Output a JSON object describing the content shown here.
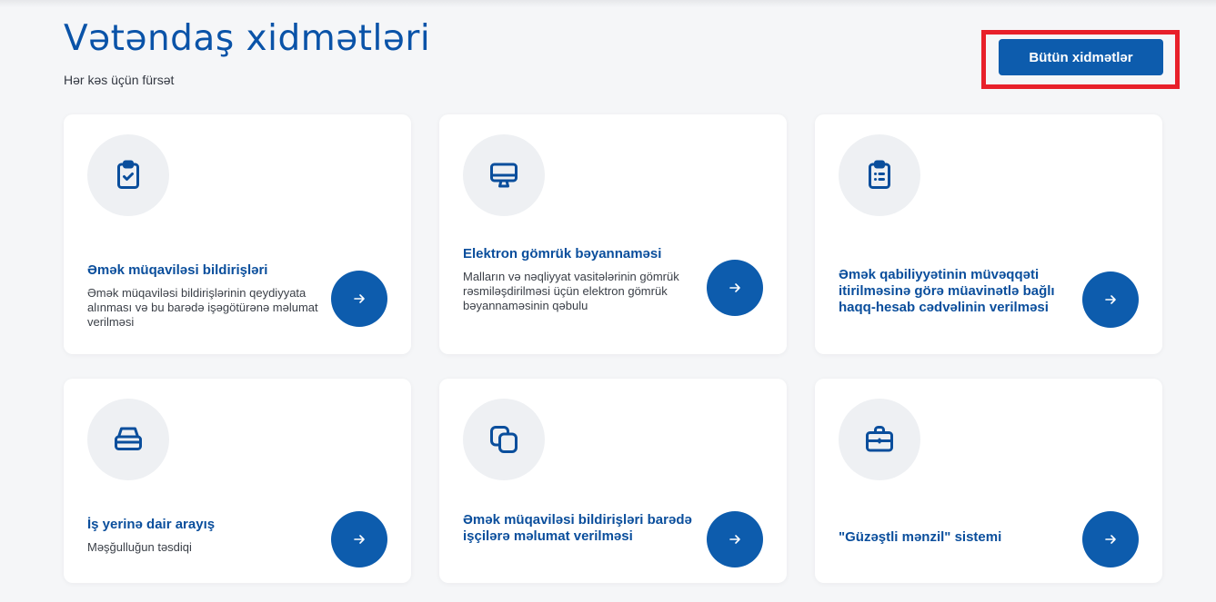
{
  "header": {
    "title": "Vətəndaş xidmətləri",
    "subtitle": "Hər kəs üçün fürsət",
    "all_services_label": "Bütün xidmətlər"
  },
  "colors": {
    "accent": "#0d5cad",
    "title": "#0a53a8",
    "highlight_frame": "#e8202a",
    "card_bg": "#ffffff",
    "page_bg": "#f5f6f8"
  },
  "cards": [
    {
      "icon": "clipboard-check-icon",
      "title": "Əmək müqaviləsi bildirişləri",
      "description": "Əmək müqaviləsi bildirişlərinin qeydiyyata alınması və bu barədə işəgötürənə məlumat verilməsi"
    },
    {
      "icon": "monitor-icon",
      "title": "Elektron gömrük bəyannaməsi",
      "description": "Malların və nəqliyyat vasitələrinin gömrük rəsmiləşdirilməsi üçün elektron gömrük bəyannaməsinin qəbulu"
    },
    {
      "icon": "clipboard-list-icon",
      "title": "Əmək qabiliyyətinin müvəqqəti itirilməsinə görə müavinətlə bağlı haqq-hesab cədvəlinin verilməsi",
      "description": ""
    },
    {
      "icon": "inbox-tray-icon",
      "title": "İş yerinə dair arayış",
      "description": "Məşğulluğun təsdiqi"
    },
    {
      "icon": "copy-icon",
      "title": "Əmək müqaviləsi bildirişləri barədə işçilərə məlumat verilməsi",
      "description": ""
    },
    {
      "icon": "briefcase-icon",
      "title": "\"Güzəştli mənzil\" sistemi",
      "description": ""
    }
  ]
}
